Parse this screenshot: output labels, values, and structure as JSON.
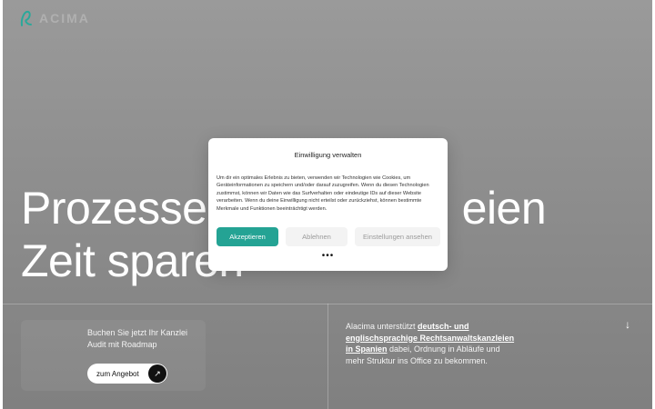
{
  "brand": {
    "name": "ACIMA",
    "accent": "#24a394"
  },
  "hero": {
    "headline_line1": "Prozesse,",
    "headline_line2_hidden": "eien",
    "headline_line3": "Zeit sparen"
  },
  "audit_card": {
    "text": "Buchen Sie jetzt Ihr Kanzlei Audit mit Roadmap",
    "button_label": "zum Angebot",
    "button_icon": "arrow-up-right-icon"
  },
  "info": {
    "prefix": "Alacima unterstützt ",
    "link": "deutsch- und englischsprachige Rechtsanwaltskanzleien in Spanien",
    "suffix": " dabei, Ordnung in Abläufe und mehr Struktur ins Office zu bekommen.",
    "scroll_icon": "arrow-down-icon"
  },
  "consent": {
    "title": "Einwilligung verwalten",
    "body": "Um dir ein optimales Erlebnis zu bieten, verwenden wir Technologien wie Cookies, um Geräteinformationen zu speichern und/oder darauf zuzugreifen. Wenn du diesen Technologien zustimmst, können wir Daten wie das Surfverhalten oder eindeutige IDs auf dieser Website verarbeiten. Wenn du deine Einwilligung nicht erteilst oder zurückziehst, können bestimmte Merkmale und Funktionen beeinträchtigt werden.",
    "accept_label": "Akzeptieren",
    "deny_label": "Ablehnen",
    "prefs_label": "Einstellungen ansehen",
    "more_label": "•••"
  }
}
